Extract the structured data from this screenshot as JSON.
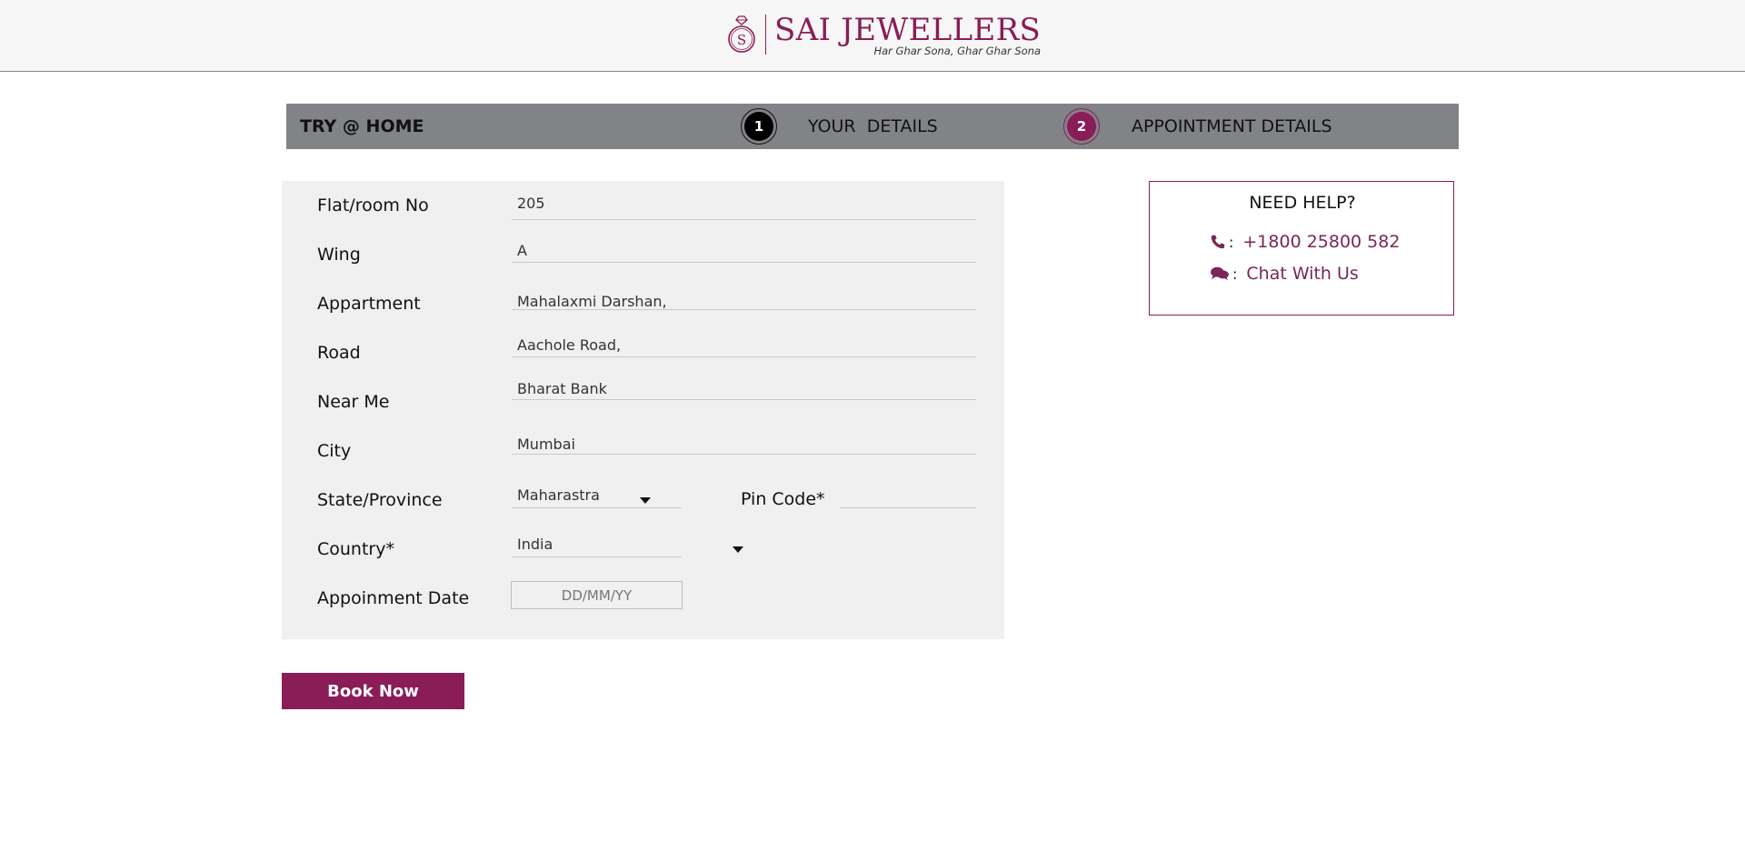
{
  "brand": {
    "name": "SAI JEWELLERS",
    "tagline": "Har Ghar Sona, Ghar Ghar Sona",
    "monogram": "S",
    "accent_color": "#8a1c57"
  },
  "steps": {
    "title": "TRY @ HOME",
    "items": [
      {
        "number": "1",
        "label": "YOUR  DETAILS",
        "state": "active"
      },
      {
        "number": "2",
        "label": "APPOINTMENT DETAILS",
        "state": "current"
      }
    ]
  },
  "form": {
    "flat": {
      "label": "Flat/room No",
      "value": "205"
    },
    "wing": {
      "label": "Wing",
      "value": "A"
    },
    "apartment": {
      "label": "Appartment",
      "value": "Mahalaxmi Darshan,"
    },
    "road": {
      "label": "Road",
      "value": "Aachole Road,"
    },
    "near": {
      "label": "Near Me",
      "value": "Bharat Bank"
    },
    "city": {
      "label": "City",
      "value": "Mumbai"
    },
    "state": {
      "label": "State/Province",
      "value": "Maharastra"
    },
    "pin": {
      "label": "Pin Code*",
      "value": ""
    },
    "country": {
      "label": "Country*",
      "value": "India"
    },
    "date": {
      "label": "Appoinment Date",
      "placeholder": "DD/MM/YY"
    }
  },
  "book_button": "Book Now",
  "help": {
    "title": "NEED HELP?",
    "phone": "+1800 25800 582",
    "chat": "Chat With Us",
    "colon": ":"
  }
}
